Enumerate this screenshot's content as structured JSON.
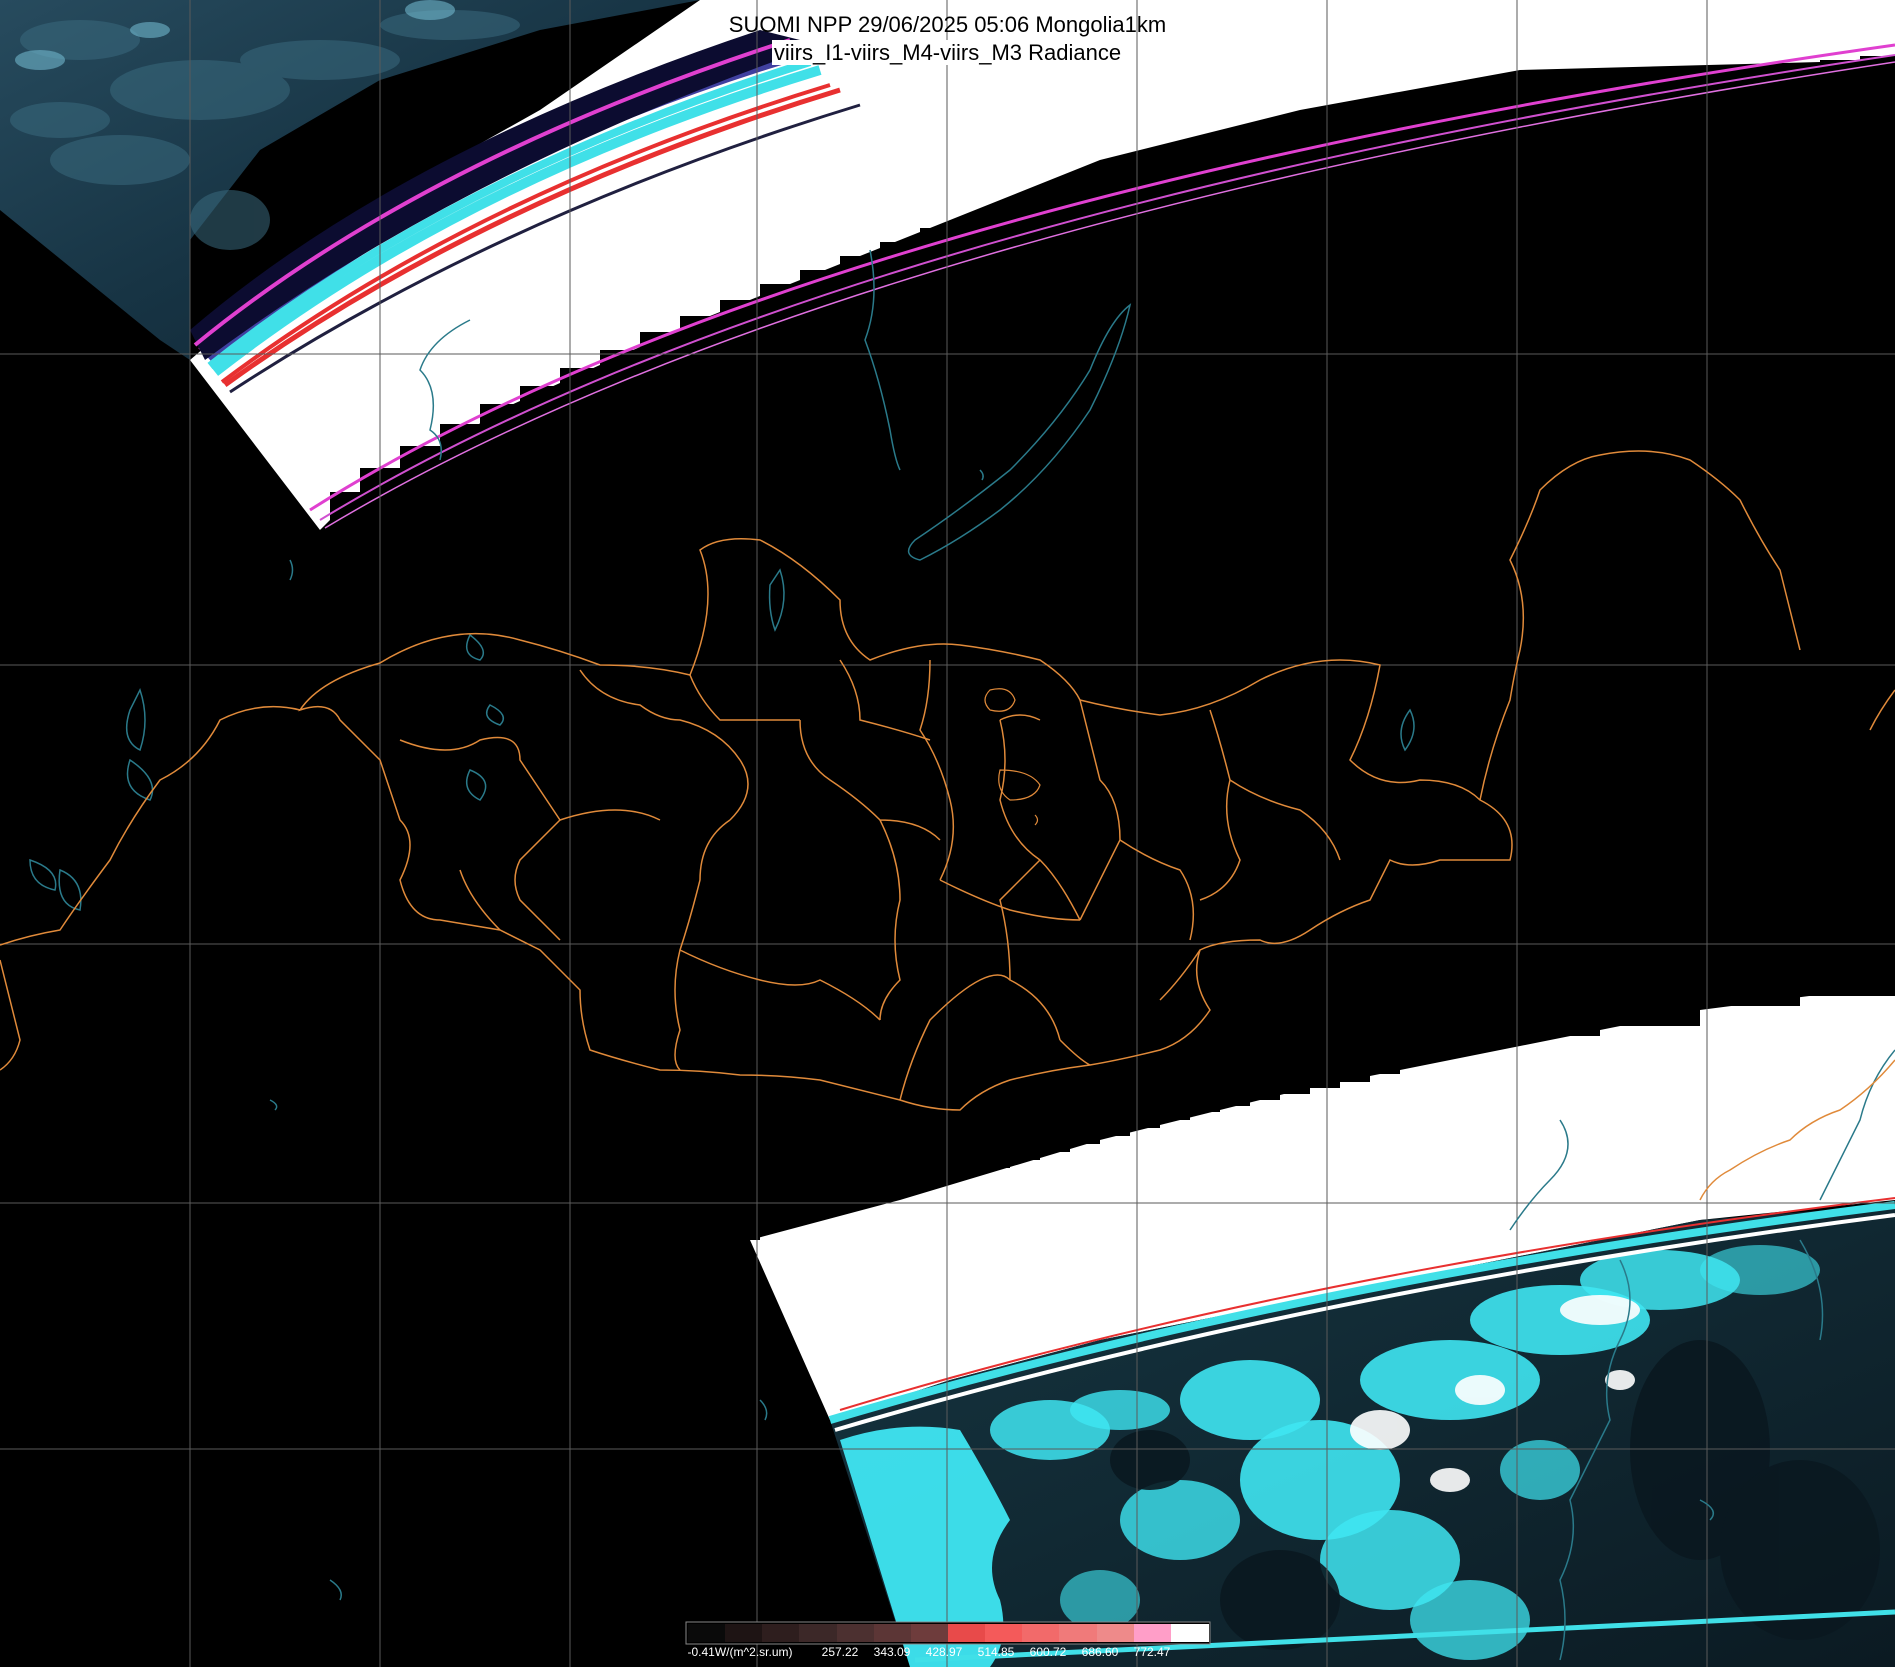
{
  "title": {
    "line1": "SUOMI NPP 29/06/2025 05:06 Mongolia1km",
    "line2": "viirs_I1-viirs_M4-viirs_M3 Radiance"
  },
  "colorbar": {
    "labels": [
      "-0.41W/(m^2.sr.um)",
      "257.22",
      "343.09",
      "428.97",
      "514.85",
      "600.72",
      "686.60",
      "772.47"
    ],
    "colors": [
      "#0a0a0a",
      "#1e1414",
      "#2e1e1e",
      "#3c2828",
      "#4c3030",
      "#5c3636",
      "#6e3c3c",
      "#e84a4a",
      "#f45a5a",
      "#f26a6a",
      "#f07a7a",
      "#ee8a8a",
      "#ff9ec8",
      "#ffffff"
    ]
  },
  "colors": {
    "background": "#000000",
    "swath_white": "#ffffff",
    "border": "#e08a3a",
    "coastline": "#2a7a8a",
    "grid": "#5a5a5a",
    "cloud_cyan": "#3fe6f2",
    "magenta_band": "#e040d0",
    "red_band": "#e83030"
  }
}
